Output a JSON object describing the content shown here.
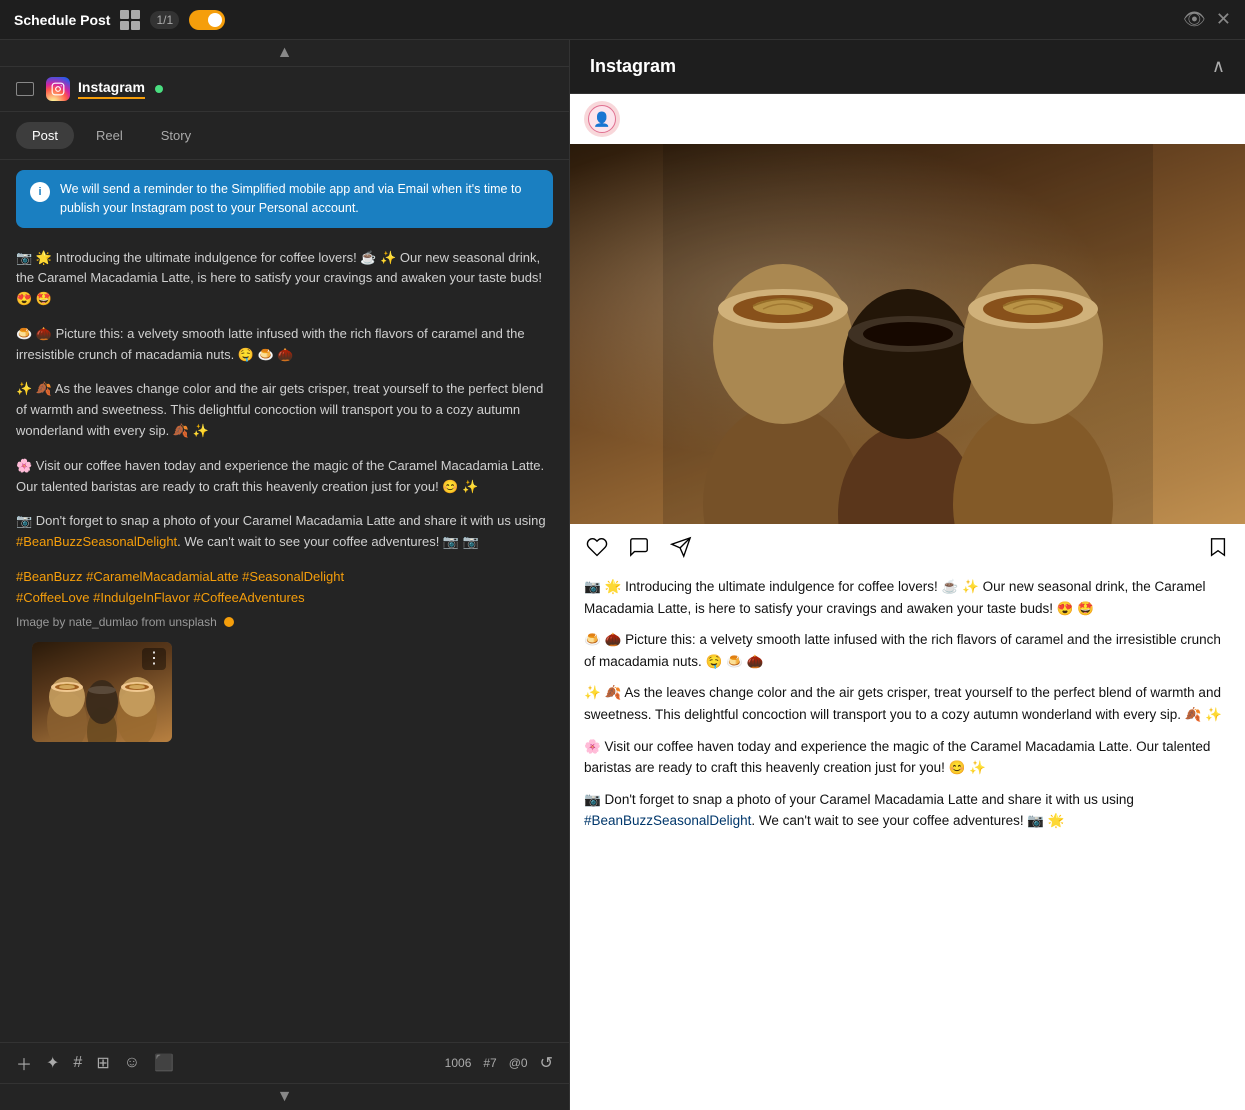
{
  "topbar": {
    "title": "Schedule Post",
    "counter": "1/1",
    "eyeSlashIcon": "eye-slash",
    "closeIcon": "close"
  },
  "platform": {
    "name": "Instagram",
    "connected": true
  },
  "tabs": {
    "post": "Post",
    "reel": "Reel",
    "story": "Story",
    "active": "post"
  },
  "notification": {
    "text": "We will send a reminder to the Simplified mobile app and via Email when it's time to publish your Instagram post to your Personal account."
  },
  "postContent": {
    "paragraph1": "📷 🌟 Introducing the ultimate indulgence for coffee lovers! ☕ ✨ Our new seasonal drink, the Caramel Macadamia Latte, is here to satisfy your cravings and awaken your taste buds! 😍 🤩",
    "paragraph2": "🍮 🌰 Picture this: a velvety smooth latte infused with the rich flavors of caramel and the irresistible crunch of macadamia nuts. 🤤 🍮 🌰",
    "paragraph3": "✨ 🍂 As the leaves change color and the air gets crisper, treat yourself to the perfect blend of warmth and sweetness. This delightful concoction will transport you to a cozy autumn wonderland with every sip. 🍂 ✨",
    "paragraph4": "🌸 Visit our coffee haven today and experience the magic of the Caramel Macadamia Latte. Our talented baristas are ready to craft this heavenly creation just for you! 😊 ✨",
    "paragraph5": "📷 Don't forget to snap a photo of your Caramel Macadamia Latte and share it with us using #BeanBuzzSeasonalDelight. We can't wait to see your coffee adventures! 📷 📷",
    "hashtags": "#BeanBuzz #CaramelMacadamiaLatte #SeasonalDelight\n#CoffeeLove #IndulgeInFlavor #CoffeeAdventures",
    "credit": "Image by nate_dumlao from unsplash"
  },
  "toolbar": {
    "charCount": "1006",
    "hashtagCount": "#7",
    "atCount": "@0"
  },
  "preview": {
    "title": "Instagram"
  },
  "igCaption": {
    "p1": "📷 🌟 Introducing the ultimate indulgence for coffee lovers! ☕ ✨ Our new seasonal drink, the Caramel Macadamia Latte, is here to satisfy your cravings and awaken your taste buds! 😍 🤩",
    "p2": "🍮 🌰 Picture this: a velvety smooth latte infused with the rich flavors of caramel and the irresistible crunch of macadamia nuts. 🤤 🍮 🌰",
    "p3": "✨ 🍂 As the leaves change color and the air gets crisper, treat yourself to the perfect blend of warmth and sweetness. This delightful concoction will transport you to a cozy autumn wonderland with every sip. 🍂 ✨",
    "p4": "🌸 Visit our coffee haven today and experience the magic of the Caramel Macadamia Latte. Our talented baristas are ready to craft this heavenly creation just for you! 😊 ✨",
    "p5": "📷 Don't forget to snap a photo of your Caramel Macadamia Latte and share it with us using ",
    "hashtag": "#BeanBuzzSeasonalDelight",
    "p5end": ". We can't wait to see your coffee adventures! 📷 🌟"
  }
}
